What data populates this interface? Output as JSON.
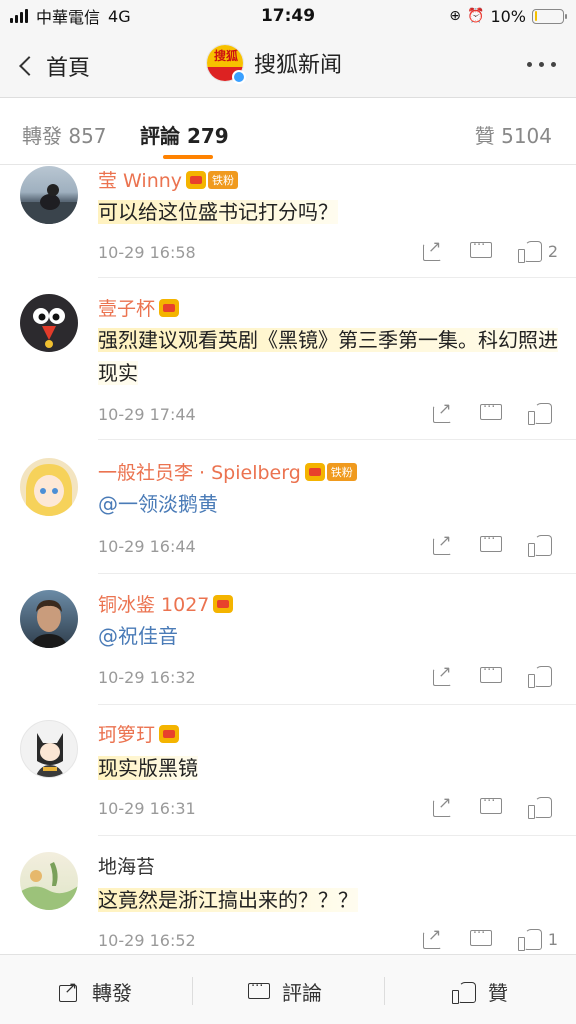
{
  "status_bar": {
    "carrier": "中華電信",
    "network": "4G",
    "time": "17:49",
    "battery_percent_label": "10%",
    "battery_level": 0.1
  },
  "nav": {
    "back_label": "首頁",
    "title": "搜狐新闻",
    "logo_text": "搜狐"
  },
  "tabs": {
    "repost": "轉發 857",
    "comment": "評論 279",
    "like": "贊 5104"
  },
  "comments": [
    {
      "name": "莹 Winny",
      "badge": "铁粉",
      "text": "可以给这位盛书记打分吗？",
      "time": "10-29 16:58",
      "likes": "2",
      "avatar": "person-on-rock"
    },
    {
      "name": "壹子杯",
      "badge": "",
      "text": "强烈建议观看英剧《黑镜》第三季第一集。科幻照进现实",
      "time": "10-29 17:44",
      "likes": "",
      "avatar": "cartoon-bird"
    },
    {
      "name": "一般社员李 · Spielberg",
      "badge": "铁粉",
      "mention": "@一领淡鹅黄",
      "time": "10-29 16:44",
      "likes": "",
      "avatar": "anime-girl"
    },
    {
      "name": "铜冰鉴 1027",
      "badge": "",
      "mention": "@祝佳音",
      "time": "10-29 16:32",
      "likes": "",
      "avatar": "man-portrait"
    },
    {
      "name": "珂箩玎",
      "badge": "",
      "text": "现实版黑镜",
      "time": "10-29 16:31",
      "likes": "",
      "avatar": "cartoon-cat"
    },
    {
      "name": "地海苔",
      "badge": "",
      "text": "这竟然是浙江搞出来的？？？",
      "time": "10-29 16:52",
      "likes": "1",
      "avatar": "landscape-painting"
    }
  ],
  "bottom_bar": {
    "repost": "轉發",
    "comment": "評論",
    "like": "贊"
  },
  "colors": {
    "accent": "#ff8200",
    "username": "#eb7350",
    "mention": "#4a7bb7"
  }
}
